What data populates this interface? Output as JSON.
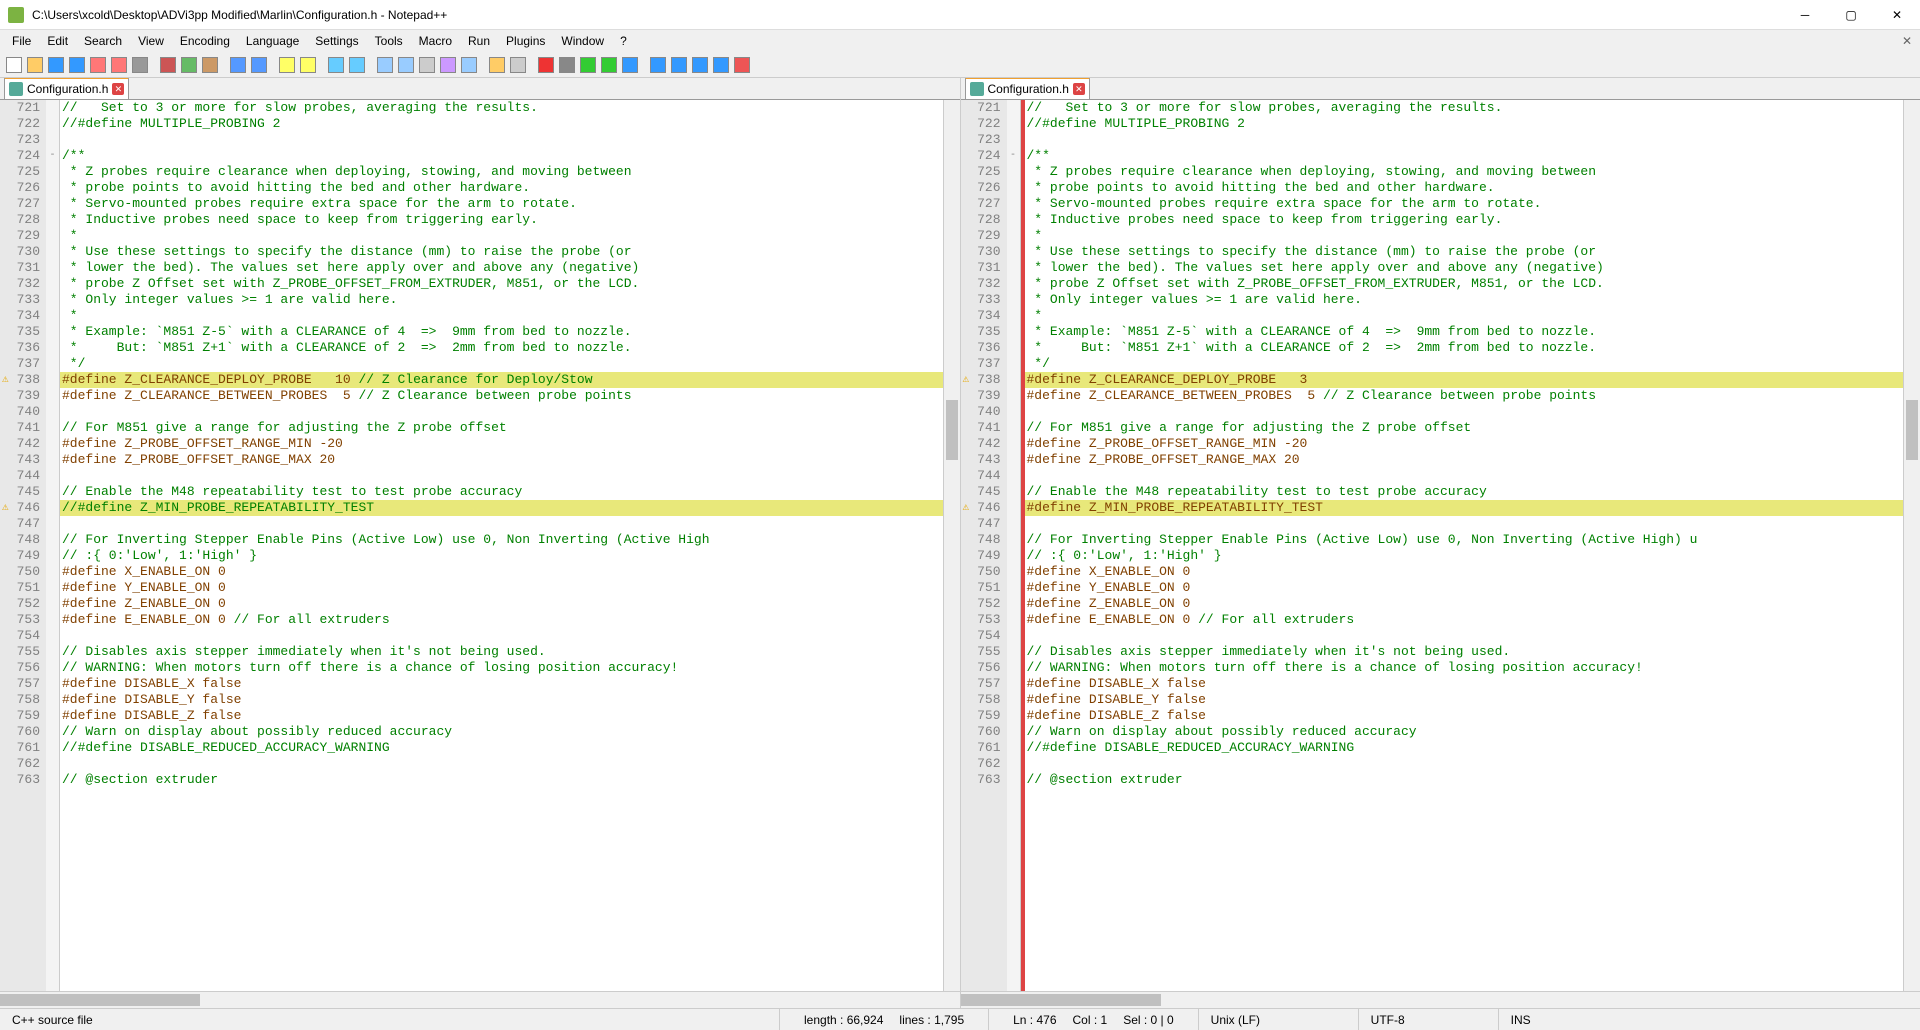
{
  "title": "C:\\Users\\xcold\\Desktop\\ADVi3pp Modified\\Marlin\\Configuration.h - Notepad++",
  "menu": [
    "File",
    "Edit",
    "Search",
    "View",
    "Encoding",
    "Language",
    "Settings",
    "Tools",
    "Macro",
    "Run",
    "Plugins",
    "Window",
    "?"
  ],
  "tabs": {
    "left": "Configuration.h",
    "right": "Configuration.h"
  },
  "status": {
    "filetype": "C++ source file",
    "length": "length : 66,924",
    "lines": "lines : 1,795",
    "ln": "Ln : 476",
    "col": "Col : 1",
    "sel": "Sel : 0 | 0",
    "eol": "Unix (LF)",
    "enc": "UTF-8",
    "ins": "INS"
  },
  "first_line": 721,
  "left_code": [
    {
      "t": "//   Set to 3 or more for slow probes, averaging the results.",
      "c": "c-comment"
    },
    {
      "t": "//#define MULTIPLE_PROBING 2",
      "c": "c-comment"
    },
    {
      "t": ""
    },
    {
      "t": "/**",
      "c": "c-comment",
      "fold": "-"
    },
    {
      "t": " * Z probes require clearance when deploying, stowing, and moving between",
      "c": "c-comment"
    },
    {
      "t": " * probe points to avoid hitting the bed and other hardware.",
      "c": "c-comment"
    },
    {
      "t": " * Servo-mounted probes require extra space for the arm to rotate.",
      "c": "c-comment"
    },
    {
      "t": " * Inductive probes need space to keep from triggering early.",
      "c": "c-comment"
    },
    {
      "t": " *",
      "c": "c-comment"
    },
    {
      "t": " * Use these settings to specify the distance (mm) to raise the probe (or",
      "c": "c-comment"
    },
    {
      "t": " * lower the bed). The values set here apply over and above any (negative)",
      "c": "c-comment"
    },
    {
      "t": " * probe Z Offset set with Z_PROBE_OFFSET_FROM_EXTRUDER, M851, or the LCD.",
      "c": "c-comment"
    },
    {
      "t": " * Only integer values >= 1 are valid here.",
      "c": "c-comment"
    },
    {
      "t": " *",
      "c": "c-comment"
    },
    {
      "t": " * Example: `M851 Z-5` with a CLEARANCE of 4  =>  9mm from bed to nozzle.",
      "c": "c-comment"
    },
    {
      "t": " *     But: `M851 Z+1` with a CLEARANCE of 2  =>  2mm from bed to nozzle.",
      "c": "c-comment"
    },
    {
      "t": " */",
      "c": "c-comment"
    },
    {
      "t": "#define Z_CLEARANCE_DEPLOY_PROBE   10 // Z Clearance for Deploy/Stow",
      "c": "c-define",
      "hl": true,
      "warn": true,
      "diffval": "10"
    },
    {
      "t": "#define Z_CLEARANCE_BETWEEN_PROBES  5 // Z Clearance between probe points",
      "c": "c-define"
    },
    {
      "t": ""
    },
    {
      "t": "// For M851 give a range for adjusting the Z probe offset",
      "c": "c-comment"
    },
    {
      "t": "#define Z_PROBE_OFFSET_RANGE_MIN -20",
      "c": "c-define"
    },
    {
      "t": "#define Z_PROBE_OFFSET_RANGE_MAX 20",
      "c": "c-define"
    },
    {
      "t": ""
    },
    {
      "t": "// Enable the M48 repeatability test to test probe accuracy",
      "c": "c-comment"
    },
    {
      "t": "//#define Z_MIN_PROBE_REPEATABILITY_TEST",
      "c": "c-comment",
      "hl": true,
      "warn": true
    },
    {
      "t": ""
    },
    {
      "t": "// For Inverting Stepper Enable Pins (Active Low) use 0, Non Inverting (Active High",
      "c": "c-comment"
    },
    {
      "t": "// :{ 0:'Low', 1:'High' }",
      "c": "c-comment"
    },
    {
      "t": "#define X_ENABLE_ON 0",
      "c": "c-define"
    },
    {
      "t": "#define Y_ENABLE_ON 0",
      "c": "c-define"
    },
    {
      "t": "#define Z_ENABLE_ON 0",
      "c": "c-define"
    },
    {
      "t": "#define E_ENABLE_ON 0 // For all extruders",
      "c": "c-define"
    },
    {
      "t": ""
    },
    {
      "t": "// Disables axis stepper immediately when it's not being used.",
      "c": "c-comment"
    },
    {
      "t": "// WARNING: When motors turn off there is a chance of losing position accuracy!",
      "c": "c-comment"
    },
    {
      "t": "#define DISABLE_X false",
      "c": "c-define"
    },
    {
      "t": "#define DISABLE_Y false",
      "c": "c-define"
    },
    {
      "t": "#define DISABLE_Z false",
      "c": "c-define"
    },
    {
      "t": "// Warn on display about possibly reduced accuracy",
      "c": "c-comment"
    },
    {
      "t": "//#define DISABLE_REDUCED_ACCURACY_WARNING",
      "c": "c-comment"
    },
    {
      "t": ""
    },
    {
      "t": "// @section extruder",
      "c": "c-comment"
    }
  ],
  "right_code": [
    {
      "t": "//   Set to 3 or more for slow probes, averaging the results.",
      "c": "c-comment"
    },
    {
      "t": "//#define MULTIPLE_PROBING 2",
      "c": "c-comment"
    },
    {
      "t": ""
    },
    {
      "t": "/**",
      "c": "c-comment",
      "fold": "-"
    },
    {
      "t": " * Z probes require clearance when deploying, stowing, and moving between",
      "c": "c-comment"
    },
    {
      "t": " * probe points to avoid hitting the bed and other hardware.",
      "c": "c-comment"
    },
    {
      "t": " * Servo-mounted probes require extra space for the arm to rotate.",
      "c": "c-comment"
    },
    {
      "t": " * Inductive probes need space to keep from triggering early.",
      "c": "c-comment"
    },
    {
      "t": " *",
      "c": "c-comment"
    },
    {
      "t": " * Use these settings to specify the distance (mm) to raise the probe (or",
      "c": "c-comment"
    },
    {
      "t": " * lower the bed). The values set here apply over and above any (negative)",
      "c": "c-comment"
    },
    {
      "t": " * probe Z Offset set with Z_PROBE_OFFSET_FROM_EXTRUDER, M851, or the LCD.",
      "c": "c-comment"
    },
    {
      "t": " * Only integer values >= 1 are valid here.",
      "c": "c-comment"
    },
    {
      "t": " *",
      "c": "c-comment"
    },
    {
      "t": " * Example: `M851 Z-5` with a CLEARANCE of 4  =>  9mm from bed to nozzle.",
      "c": "c-comment"
    },
    {
      "t": " *     But: `M851 Z+1` with a CLEARANCE of 2  =>  2mm from bed to nozzle.",
      "c": "c-comment"
    },
    {
      "t": " */",
      "c": "c-comment"
    },
    {
      "t": "#define Z_CLEARANCE_DEPLOY_PROBE   3",
      "c": "c-define",
      "hl": true,
      "warn": true,
      "diffval": "3"
    },
    {
      "t": "#define Z_CLEARANCE_BETWEEN_PROBES  5 // Z Clearance between probe points",
      "c": "c-define"
    },
    {
      "t": ""
    },
    {
      "t": "// For M851 give a range for adjusting the Z probe offset",
      "c": "c-comment"
    },
    {
      "t": "#define Z_PROBE_OFFSET_RANGE_MIN -20",
      "c": "c-define"
    },
    {
      "t": "#define Z_PROBE_OFFSET_RANGE_MAX 20",
      "c": "c-define"
    },
    {
      "t": ""
    },
    {
      "t": "// Enable the M48 repeatability test to test probe accuracy",
      "c": "c-comment"
    },
    {
      "t": "#define Z_MIN_PROBE_REPEATABILITY_TEST",
      "c": "c-define",
      "hl": true,
      "warn": true
    },
    {
      "t": ""
    },
    {
      "t": "// For Inverting Stepper Enable Pins (Active Low) use 0, Non Inverting (Active High) u",
      "c": "c-comment"
    },
    {
      "t": "// :{ 0:'Low', 1:'High' }",
      "c": "c-comment"
    },
    {
      "t": "#define X_ENABLE_ON 0",
      "c": "c-define"
    },
    {
      "t": "#define Y_ENABLE_ON 0",
      "c": "c-define"
    },
    {
      "t": "#define Z_ENABLE_ON 0",
      "c": "c-define"
    },
    {
      "t": "#define E_ENABLE_ON 0 // For all extruders",
      "c": "c-define"
    },
    {
      "t": ""
    },
    {
      "t": "// Disables axis stepper immediately when it's not being used.",
      "c": "c-comment"
    },
    {
      "t": "// WARNING: When motors turn off there is a chance of losing position accuracy!",
      "c": "c-comment"
    },
    {
      "t": "#define DISABLE_X false",
      "c": "c-define"
    },
    {
      "t": "#define DISABLE_Y false",
      "c": "c-define"
    },
    {
      "t": "#define DISABLE_Z false",
      "c": "c-define"
    },
    {
      "t": "// Warn on display about possibly reduced accuracy",
      "c": "c-comment"
    },
    {
      "t": "//#define DISABLE_REDUCED_ACCURACY_WARNING",
      "c": "c-comment"
    },
    {
      "t": ""
    },
    {
      "t": "// @section extruder",
      "c": "c-comment"
    }
  ],
  "toolbar_icons": [
    "new",
    "open",
    "save",
    "save-all",
    "close",
    "close-all",
    "print",
    "sep",
    "cut",
    "copy",
    "paste",
    "sep",
    "undo",
    "redo",
    "sep",
    "find",
    "replace",
    "sep",
    "zoom-in",
    "zoom-out",
    "sep",
    "sync-v",
    "sync-h",
    "wrap",
    "all-chars",
    "indent-guide",
    "sep",
    "lang",
    "monitor",
    "sep",
    "record",
    "stop",
    "play",
    "play-multi",
    "save-macro",
    "sep",
    "diff-first",
    "diff-prev",
    "diff-next",
    "diff-last",
    "spell"
  ]
}
